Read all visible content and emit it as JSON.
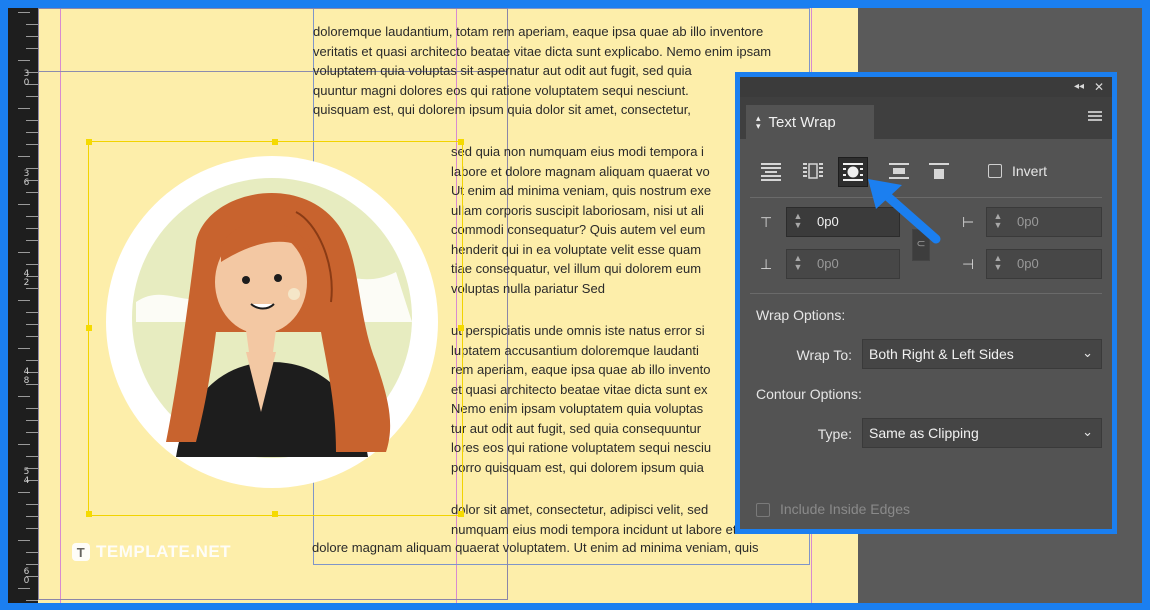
{
  "document": {
    "top_lines": [
      "doloremque laudantium, totam rem aperiam, eaque ipsa quae ab illo inventore",
      "veritatis et quasi architecto beatae vitae dicta sunt explicabo. Nemo enim ipsam",
      "voluptatem quia voluptas sit aspernatur aut odit aut fugit, sed quia",
      "quuntur magni dolores eos qui ratione voluptatem sequi nesciunt.",
      "quisquam est, qui dolorem ipsum quia dolor sit amet, consectetur,"
    ],
    "right_lines_1": [
      "sed quia non numquam eius modi tempora i",
      "labore et dolore magnam aliquam quaerat vo",
      "Ut enim ad minima veniam, quis nostrum exe",
      "ullam corporis suscipit laboriosam, nisi ut ali",
      "commodi consequatur? Quis autem vel eum",
      "henderit qui in ea voluptate velit esse quam",
      "tiae consequatur, vel illum qui dolorem eum",
      "voluptas nulla pariatur Sed"
    ],
    "right_lines_2": [
      "ut perspiciatis unde omnis iste natus error si",
      "luptatem accusantium doloremque laudanti",
      "rem aperiam, eaque ipsa quae ab illo invento",
      "et quasi architecto beatae vitae dicta sunt ex",
      "Nemo enim ipsam voluptatem quia voluptas",
      "tur aut odit aut fugit, sed quia consequuntur",
      "lores eos qui ratione voluptatem sequi nesciu",
      "porro quisquam est, qui dolorem ipsum quia"
    ],
    "right_lines_3": [
      "dolor sit amet, consectetur, adipisci velit, sed",
      "numquam eius modi tempora incidunt ut labore et"
    ],
    "bottom_line": "dolore magnam aliquam quaerat voluptatem. Ut enim ad minima veniam, quis",
    "logo_text": "TEMPLATE.NET",
    "logo_mark": "T"
  },
  "ruler": {
    "labels": [
      "3\n0",
      "3\n6",
      "4\n2",
      "4\n8",
      "5\n4",
      "6\n0"
    ]
  },
  "panel": {
    "title": "Text Wrap",
    "tab_icon": "collapse-arrows-icon",
    "titlebar_collapse": "◂◂",
    "titlebar_close": "✕",
    "wrap_buttons": [
      "no-wrap-icon",
      "wrap-bounding-box-icon",
      "wrap-object-shape-icon",
      "jump-object-icon",
      "jump-next-column-icon"
    ],
    "active_wrap_index": 2,
    "invert_label": "Invert",
    "invert_checked": false,
    "offsets": {
      "top": "0p0",
      "bottom": "0p0",
      "left": "0p0",
      "right": "0p0"
    },
    "wrap_options_label": "Wrap Options:",
    "wrap_to_label": "Wrap To:",
    "wrap_to_value": "Both Right & Left Sides",
    "contour_options_label": "Contour Options:",
    "type_label": "Type:",
    "type_value": "Same as Clipping",
    "include_inside_edges_label": "Include Inside Edges",
    "include_inside_edges_checked": false
  },
  "colors": {
    "accent": "#1b7ff0",
    "page": "#fdeeaa",
    "panel_bg": "#535353",
    "selection": "#f2d300"
  }
}
